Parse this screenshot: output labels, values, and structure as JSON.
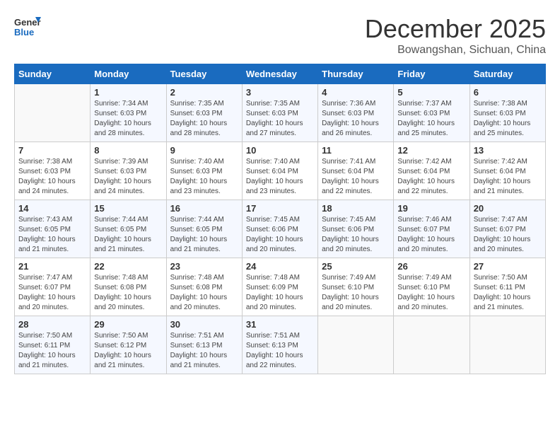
{
  "header": {
    "logo_line1": "General",
    "logo_line2": "Blue",
    "month": "December 2025",
    "location": "Bowangshan, Sichuan, China"
  },
  "days_of_week": [
    "Sunday",
    "Monday",
    "Tuesday",
    "Wednesday",
    "Thursday",
    "Friday",
    "Saturday"
  ],
  "weeks": [
    [
      {
        "date": "",
        "info": ""
      },
      {
        "date": "1",
        "info": "Sunrise: 7:34 AM\nSunset: 6:03 PM\nDaylight: 10 hours\nand 28 minutes."
      },
      {
        "date": "2",
        "info": "Sunrise: 7:35 AM\nSunset: 6:03 PM\nDaylight: 10 hours\nand 28 minutes."
      },
      {
        "date": "3",
        "info": "Sunrise: 7:35 AM\nSunset: 6:03 PM\nDaylight: 10 hours\nand 27 minutes."
      },
      {
        "date": "4",
        "info": "Sunrise: 7:36 AM\nSunset: 6:03 PM\nDaylight: 10 hours\nand 26 minutes."
      },
      {
        "date": "5",
        "info": "Sunrise: 7:37 AM\nSunset: 6:03 PM\nDaylight: 10 hours\nand 25 minutes."
      },
      {
        "date": "6",
        "info": "Sunrise: 7:38 AM\nSunset: 6:03 PM\nDaylight: 10 hours\nand 25 minutes."
      }
    ],
    [
      {
        "date": "7",
        "info": "Sunrise: 7:38 AM\nSunset: 6:03 PM\nDaylight: 10 hours\nand 24 minutes."
      },
      {
        "date": "8",
        "info": "Sunrise: 7:39 AM\nSunset: 6:03 PM\nDaylight: 10 hours\nand 24 minutes."
      },
      {
        "date": "9",
        "info": "Sunrise: 7:40 AM\nSunset: 6:03 PM\nDaylight: 10 hours\nand 23 minutes."
      },
      {
        "date": "10",
        "info": "Sunrise: 7:40 AM\nSunset: 6:04 PM\nDaylight: 10 hours\nand 23 minutes."
      },
      {
        "date": "11",
        "info": "Sunrise: 7:41 AM\nSunset: 6:04 PM\nDaylight: 10 hours\nand 22 minutes."
      },
      {
        "date": "12",
        "info": "Sunrise: 7:42 AM\nSunset: 6:04 PM\nDaylight: 10 hours\nand 22 minutes."
      },
      {
        "date": "13",
        "info": "Sunrise: 7:42 AM\nSunset: 6:04 PM\nDaylight: 10 hours\nand 21 minutes."
      }
    ],
    [
      {
        "date": "14",
        "info": "Sunrise: 7:43 AM\nSunset: 6:05 PM\nDaylight: 10 hours\nand 21 minutes."
      },
      {
        "date": "15",
        "info": "Sunrise: 7:44 AM\nSunset: 6:05 PM\nDaylight: 10 hours\nand 21 minutes."
      },
      {
        "date": "16",
        "info": "Sunrise: 7:44 AM\nSunset: 6:05 PM\nDaylight: 10 hours\nand 21 minutes."
      },
      {
        "date": "17",
        "info": "Sunrise: 7:45 AM\nSunset: 6:06 PM\nDaylight: 10 hours\nand 20 minutes."
      },
      {
        "date": "18",
        "info": "Sunrise: 7:45 AM\nSunset: 6:06 PM\nDaylight: 10 hours\nand 20 minutes."
      },
      {
        "date": "19",
        "info": "Sunrise: 7:46 AM\nSunset: 6:07 PM\nDaylight: 10 hours\nand 20 minutes."
      },
      {
        "date": "20",
        "info": "Sunrise: 7:47 AM\nSunset: 6:07 PM\nDaylight: 10 hours\nand 20 minutes."
      }
    ],
    [
      {
        "date": "21",
        "info": "Sunrise: 7:47 AM\nSunset: 6:07 PM\nDaylight: 10 hours\nand 20 minutes."
      },
      {
        "date": "22",
        "info": "Sunrise: 7:48 AM\nSunset: 6:08 PM\nDaylight: 10 hours\nand 20 minutes."
      },
      {
        "date": "23",
        "info": "Sunrise: 7:48 AM\nSunset: 6:08 PM\nDaylight: 10 hours\nand 20 minutes."
      },
      {
        "date": "24",
        "info": "Sunrise: 7:48 AM\nSunset: 6:09 PM\nDaylight: 10 hours\nand 20 minutes."
      },
      {
        "date": "25",
        "info": "Sunrise: 7:49 AM\nSunset: 6:10 PM\nDaylight: 10 hours\nand 20 minutes."
      },
      {
        "date": "26",
        "info": "Sunrise: 7:49 AM\nSunset: 6:10 PM\nDaylight: 10 hours\nand 20 minutes."
      },
      {
        "date": "27",
        "info": "Sunrise: 7:50 AM\nSunset: 6:11 PM\nDaylight: 10 hours\nand 21 minutes."
      }
    ],
    [
      {
        "date": "28",
        "info": "Sunrise: 7:50 AM\nSunset: 6:11 PM\nDaylight: 10 hours\nand 21 minutes."
      },
      {
        "date": "29",
        "info": "Sunrise: 7:50 AM\nSunset: 6:12 PM\nDaylight: 10 hours\nand 21 minutes."
      },
      {
        "date": "30",
        "info": "Sunrise: 7:51 AM\nSunset: 6:13 PM\nDaylight: 10 hours\nand 21 minutes."
      },
      {
        "date": "31",
        "info": "Sunrise: 7:51 AM\nSunset: 6:13 PM\nDaylight: 10 hours\nand 22 minutes."
      },
      {
        "date": "",
        "info": ""
      },
      {
        "date": "",
        "info": ""
      },
      {
        "date": "",
        "info": ""
      }
    ]
  ]
}
